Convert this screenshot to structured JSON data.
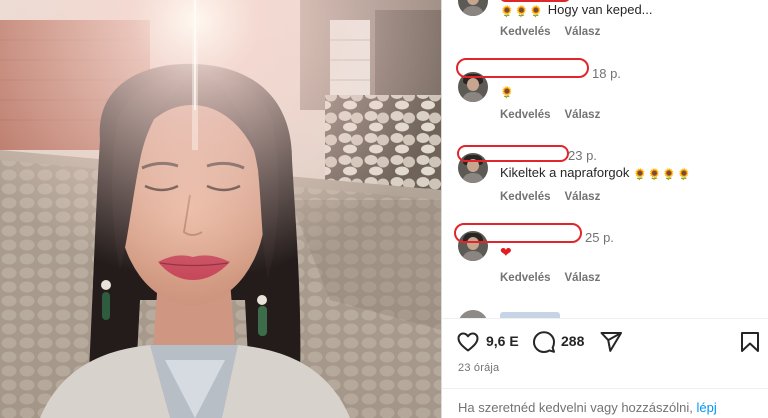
{
  "post": {
    "likes": "9,6 E",
    "comments_count": "288",
    "posted_ago": "23 órája"
  },
  "comments": [
    {
      "time": "",
      "text": "Hogy van keped...",
      "emoji_count": 3,
      "like_label": "Kedvelés",
      "reply_label": "Válasz"
    },
    {
      "time": "18 p.",
      "text": "",
      "emoji_count": 1,
      "like_label": "Kedvelés",
      "reply_label": "Válasz"
    },
    {
      "time": "23 p.",
      "text": "Kikeltek a napraforgok",
      "emoji_count": 4,
      "like_label": "Kedvelés",
      "reply_label": "Válasz"
    },
    {
      "time": "25 p.",
      "text": "",
      "heart": "❤",
      "like_label": "Kedvelés",
      "reply_label": "Válasz"
    }
  ],
  "login_prompt": {
    "text": "Ha szeretnéd kedvelni vagy hozzászólni,",
    "link": "lépj"
  },
  "icons": {
    "like": "heart-outline-icon",
    "comment": "speech-bubble-icon",
    "share": "paper-plane-icon",
    "save": "bookmark-icon"
  },
  "colors": {
    "redaction": "#e0262b",
    "link": "#0095f6",
    "muted": "#737373"
  }
}
